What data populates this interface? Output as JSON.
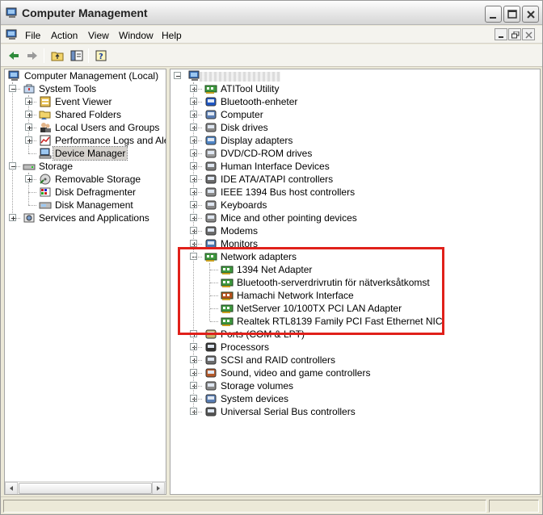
{
  "window": {
    "title": "Computer Management",
    "icon": "computer-management-icon"
  },
  "menu": {
    "items": [
      "File",
      "Action",
      "View",
      "Window",
      "Help"
    ]
  },
  "toolbar": {
    "buttons": [
      "back-arrow-icon",
      "forward-arrow-icon",
      "up-folder-icon",
      "show-hide-tree-icon",
      "help-icon"
    ]
  },
  "left_tree": {
    "root": "Computer Management (Local)",
    "system_tools": "System Tools",
    "event_viewer": "Event Viewer",
    "shared_folders": "Shared Folders",
    "local_users": "Local Users and Groups",
    "perf_logs": "Performance Logs and Alerts",
    "device_manager": "Device Manager",
    "storage": "Storage",
    "removable_storage": "Removable Storage",
    "disk_defrag": "Disk Defragmenter",
    "disk_mgmt": "Disk Management",
    "services": "Services and Applications"
  },
  "device_tree": {
    "categories": [
      "ATITool Utility",
      "Bluetooth-enheter",
      "Computer",
      "Disk drives",
      "Display adapters",
      "DVD/CD-ROM drives",
      "Human Interface Devices",
      "IDE ATA/ATAPI controllers",
      "IEEE 1394 Bus host controllers",
      "Keyboards",
      "Mice and other pointing devices",
      "Modems",
      "Monitors",
      "Network adapters",
      "Ports (COM & LPT)",
      "Processors",
      "SCSI and RAID controllers",
      "Sound, video and game controllers",
      "Storage volumes",
      "System devices",
      "Universal Serial Bus controllers"
    ],
    "network_adapters": [
      "1394 Net Adapter",
      "Bluetooth-serverdrivrutin för nätverksåtkomst",
      "Hamachi Network Interface",
      "NetServer 10/100TX PCI LAN Adapter",
      "Realtek RTL8139 Family PCI Fast Ethernet NIC"
    ]
  },
  "colors": {
    "highlight_box": "#e0201a",
    "selection": "#d6d3ce"
  }
}
